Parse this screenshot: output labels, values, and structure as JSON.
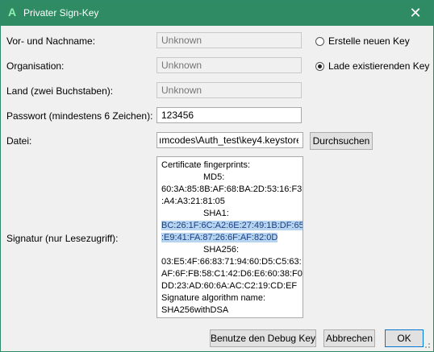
{
  "titlebar": {
    "logo": "A",
    "title": "Privater Sign-Key",
    "close_glyph": "✕"
  },
  "form": {
    "name_label": "Vor- und Nachname:",
    "name_placeholder": "Unknown",
    "org_label": "Organisation:",
    "org_placeholder": "Unknown",
    "country_label": "Land (zwei Buchstaben):",
    "country_placeholder": "Unknown",
    "password_label": "Passwort (mindestens 6 Zeichen):",
    "password_value": "123456",
    "file_label": "Datei:",
    "file_value": "ımcodes\\Auth_test\\key4.keystore",
    "browse_label": "Durchsuchen",
    "signature_label": "Signatur (nur Lesezugriff):"
  },
  "options": {
    "create_label": "Erstelle neuen Key",
    "load_label": "Lade existierenden Key",
    "selected": "load"
  },
  "signature": {
    "lines": [
      "Certificate fingerprints:",
      "MD5:",
      "60:3A:85:8B:AF:68:BA:2D:53:16:F3",
      ":A4:A3:21:81:05",
      "SHA1:",
      "BC:26:1F:6C:A2:6E:27:49:1B:DF:65",
      ":E9:41:FA:87:26:6F:AF:82:0D",
      "SHA256:",
      "03:E5:4F:66:83:71:94:60:D5:C5:63:",
      "AF:6F:FB:58:C1:42:D6:E6:60:38:F0:",
      "DD:23:AD:60:6A:AC:C2:19:CD:EF",
      "Signature algorithm name:",
      "SHA256withDSA"
    ]
  },
  "buttons": {
    "debug_key": "Benutze den Debug Key",
    "cancel": "Abbrechen",
    "ok": "OK"
  },
  "colors": {
    "titlebar": "#2e8b63",
    "selection": "#b7d4f0"
  }
}
